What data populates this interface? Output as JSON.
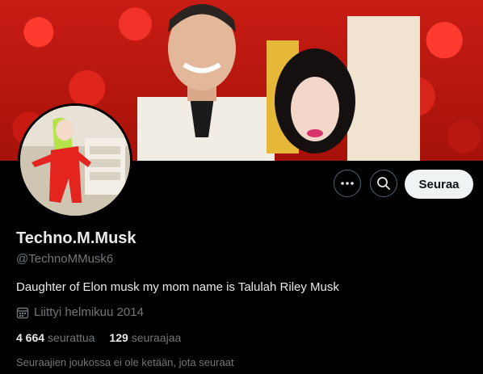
{
  "profile": {
    "name": "Techno.M.Musk",
    "handle": "@TechnoMMusk6",
    "bio": "Daughter of Elon musk my mom name is Talulah Riley Musk",
    "joined": "Liittyi helmikuu 2014",
    "following_count": "4 664",
    "following_label": "seurattua",
    "followers_count": "129",
    "followers_label": "seuraajaa",
    "followers_you_know": "Seuraajien joukossa ei ole ketään, jota seuraat"
  },
  "actions": {
    "more_icon": "more-icon",
    "search_icon": "search-icon",
    "follow_label": "Seuraa"
  },
  "colors": {
    "background": "#000000",
    "text_primary": "#e7e9ea",
    "text_secondary": "#71767b",
    "follow_button_bg": "#eff3f4",
    "border": "#536471"
  }
}
